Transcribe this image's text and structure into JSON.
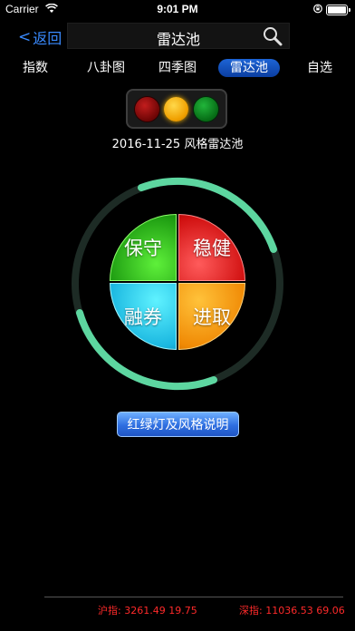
{
  "status_bar": {
    "carrier": "Carrier",
    "time": "9:01 PM"
  },
  "nav": {
    "back_label": "返回",
    "back_chevron": "<",
    "title": "雷达池",
    "search_icon": "magnifier-icon"
  },
  "tabs": [
    {
      "label": "指数",
      "active": false
    },
    {
      "label": "八卦图",
      "active": false
    },
    {
      "label": "四季图",
      "active": false
    },
    {
      "label": "雷达池",
      "active": true
    },
    {
      "label": "自选",
      "active": false
    }
  ],
  "traffic_light": {
    "lamps": [
      "red",
      "yellow",
      "green"
    ],
    "active": "yellow",
    "colors": {
      "red": "#8a0a0a",
      "yellow": "#f5b400",
      "green": "#0b8a1f"
    }
  },
  "date_line": "2016-11-25 风格雷达池",
  "radar": {
    "quadrants": [
      {
        "label": "保守",
        "color": "#2bc41a"
      },
      {
        "label": "稳健",
        "color": "#e21b1b"
      },
      {
        "label": "融券",
        "color": "#1fc4ee"
      },
      {
        "label": "进取",
        "color": "#f79a0c"
      }
    ],
    "ring_color": "#5dd6a0"
  },
  "explain_button": "红绿灯及风格说明",
  "footer": {
    "sh_label": "沪指:",
    "sh_value": "3261.49 19.75",
    "sz_label": "深指:",
    "sz_value": "11036.53 69.06"
  }
}
